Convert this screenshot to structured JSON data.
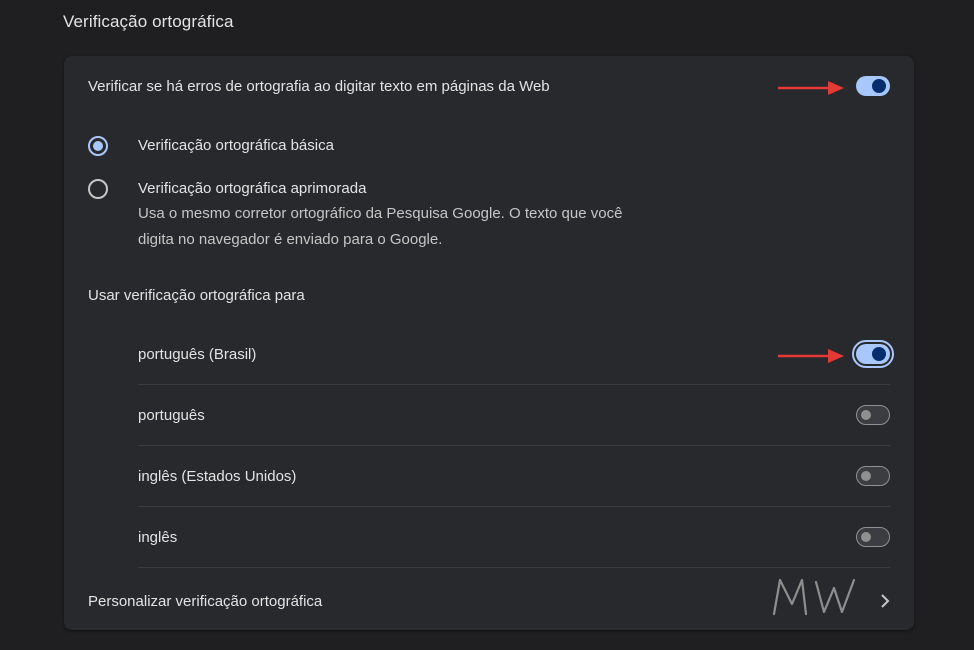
{
  "section_title": "Verificação ortográfica",
  "main_toggle": {
    "label": "Verificar se há erros de ortografia ao digitar texto em páginas da Web",
    "on": true
  },
  "mode": {
    "basic_label": "Verificação ortográfica básica",
    "enhanced_label": "Verificação ortográfica aprimorada",
    "enhanced_desc_line1": "Usa o mesmo corretor ortográfico da Pesquisa Google. O texto que você",
    "enhanced_desc_line2": "digita no navegador é enviado para o Google.",
    "selected": "basic"
  },
  "use_for_label": "Usar verificação ortográfica para",
  "languages": [
    {
      "label": "português (Brasil)",
      "on": true
    },
    {
      "label": "português",
      "on": false
    },
    {
      "label": "inglês (Estados Unidos)",
      "on": false
    },
    {
      "label": "inglês",
      "on": false
    }
  ],
  "customize_label": "Personalizar verificação ortográfica",
  "watermark_text": "MW",
  "colors": {
    "accent": "#a8c7fa",
    "annotation_arrow": "#e53935"
  },
  "icons": {
    "chevron": "chevron-right-icon",
    "arrow": "red-arrow-annotation"
  }
}
